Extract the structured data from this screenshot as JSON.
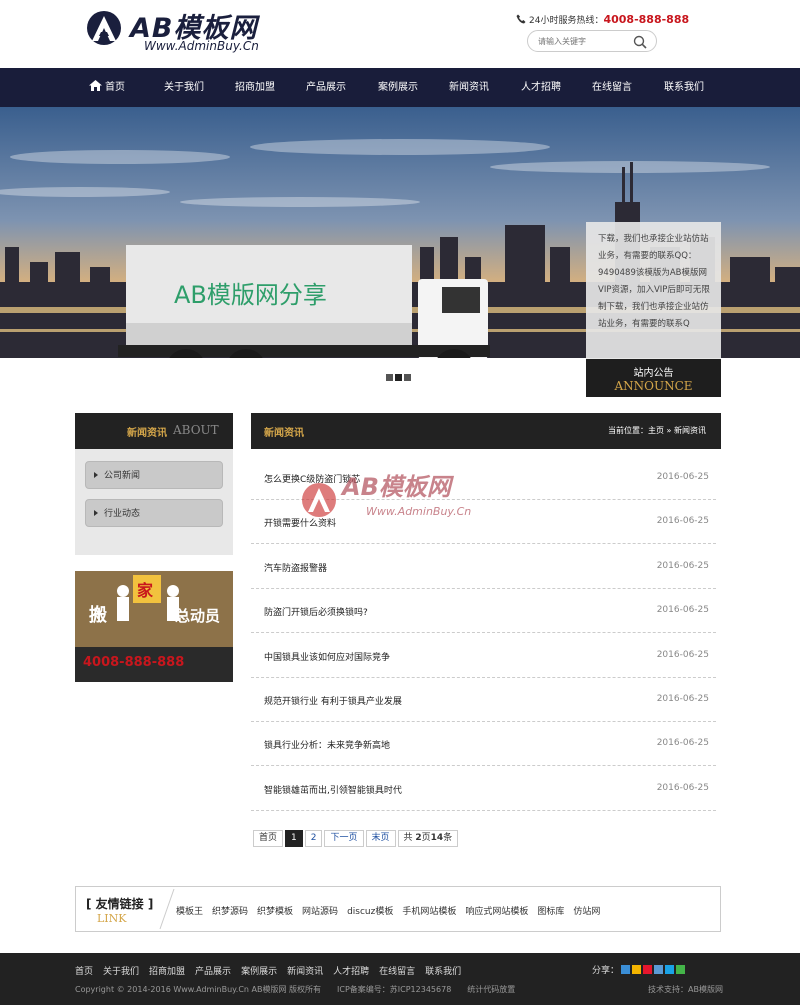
{
  "header": {
    "logo_text": "AB模板网",
    "logo_sub": "Www.AdminBuy.Cn",
    "hotline_label": "24小时服务热线：",
    "hotline_number": "4008-888-888",
    "search_placeholder": "请输入关键字"
  },
  "nav": {
    "items": [
      "首页",
      "关于我们",
      "招商加盟",
      "产品展示",
      "案例展示",
      "新闻资讯",
      "人才招聘",
      "在线留言",
      "联系我们"
    ]
  },
  "banner": {
    "truck_text": "AB模版网分享"
  },
  "announce": {
    "text": "下载，我们也承接企业站仿站业务，有需要的联系QQ：9490489该模版为AB模版网VIP资源，加入VIP后即可无限制下载，我们也承接企业站仿站业务，有需要的联系Q",
    "title": "站内公告",
    "title_en": "ANNOUNCE"
  },
  "sidebar": {
    "title": "新闻资讯",
    "title_en": "ABOUT",
    "items": [
      "公司新闻",
      "行业动态"
    ],
    "banner_text_a": "搬",
    "banner_text_b": "家",
    "banner_text_c": "总动员",
    "phone": "4008-888-888"
  },
  "main": {
    "title": "新闻资讯",
    "breadcrumb": "当前位置：主页 » 新闻资讯",
    "news": [
      {
        "title": "怎么更换C级防盗门锁芯",
        "date": "2016-06-25"
      },
      {
        "title": "开锁需要什么资料",
        "date": "2016-06-25"
      },
      {
        "title": "汽车防盗报警器",
        "date": "2016-06-25"
      },
      {
        "title": "防盗门开锁后必须换锁吗?",
        "date": "2016-06-25"
      },
      {
        "title": "中国锁具业该如何应对国际竞争",
        "date": "2016-06-25"
      },
      {
        "title": "规范开锁行业 有利于锁具产业发展",
        "date": "2016-06-25"
      },
      {
        "title": "锁具行业分析：未来竞争新高地",
        "date": "2016-06-25"
      },
      {
        "title": "智能锁雄茁而出,引领智能锁具时代",
        "date": "2016-06-25"
      }
    ],
    "watermark_text": "AB模板网",
    "watermark_sub": "Www.AdminBuy.Cn"
  },
  "pager": {
    "first": "首页",
    "page1": "1",
    "page2": "2",
    "next": "下一页",
    "last": "末页",
    "total_prefix": "共 ",
    "total_pages": "2",
    "total_mid": "页",
    "total_items": "14",
    "total_suffix": "条"
  },
  "links": {
    "title": "[ 友情链接 ]",
    "title_en": "LINK",
    "items": [
      "模板王",
      "织梦源码",
      "织梦模板",
      "网站源码",
      "discuz模板",
      "手机网站模板",
      "响应式网站模板",
      "图标库",
      "仿站网"
    ]
  },
  "footer": {
    "nav": [
      "首页",
      "关于我们",
      "招商加盟",
      "产品展示",
      "案例展示",
      "新闻资讯",
      "人才招聘",
      "在线留言",
      "联系我们"
    ],
    "copyright": "Copyright © 2014-2016 Www.AdminBuy.Cn AB模版网 版权所有　　ICP备案编号：苏ICP12345678　　统计代码放置",
    "share_label": "分享：",
    "tech": "技术支持：AB模版网"
  },
  "colors": {
    "nav_bg": "#191d3a",
    "accent_gold": "#d4a64a",
    "hotline_red": "#c8161d",
    "dark": "#222222"
  }
}
